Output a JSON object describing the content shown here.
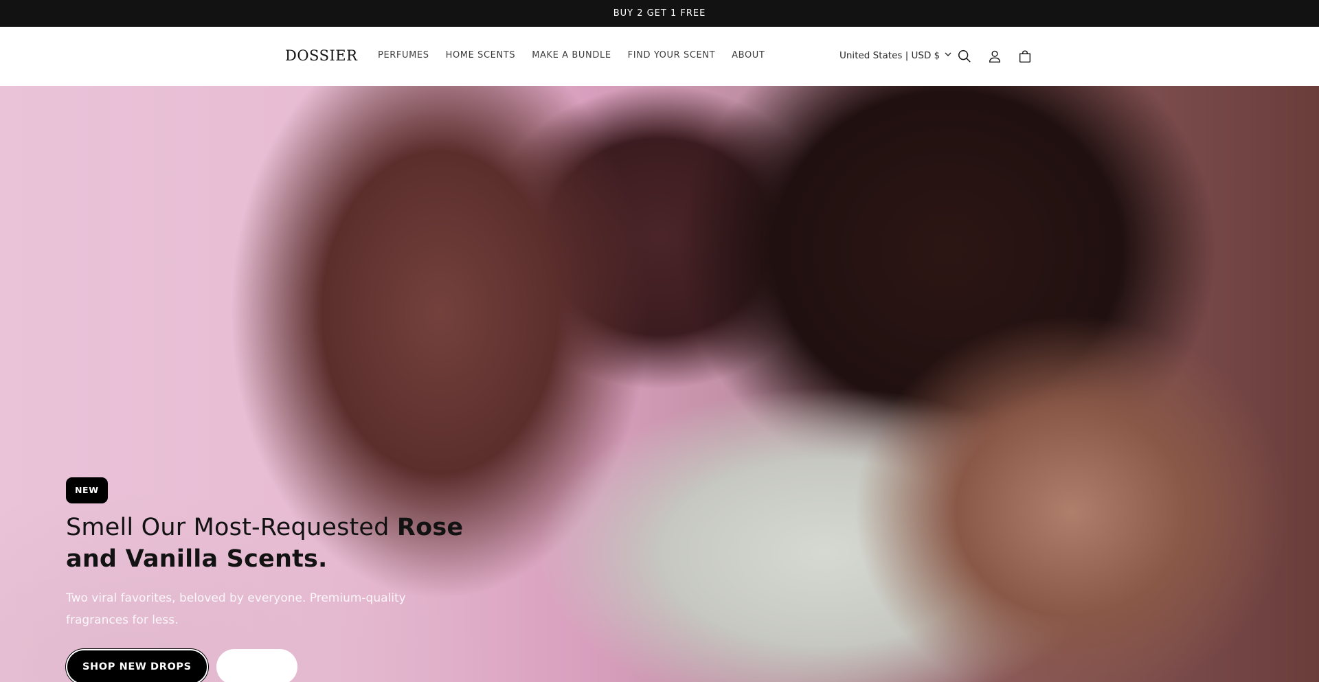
{
  "announcement": {
    "text": "BUY 2 GET 1 FREE"
  },
  "header": {
    "logo": "DOSSIER",
    "nav": [
      {
        "label": "PERFUMES"
      },
      {
        "label": "HOME SCENTS"
      },
      {
        "label": "MAKE A BUNDLE"
      },
      {
        "label": "FIND YOUR SCENT"
      },
      {
        "label": "ABOUT"
      }
    ],
    "locale": "United States | USD $",
    "icons": [
      "chevron-down-icon",
      "search-icon",
      "account-icon",
      "cart-icon"
    ]
  },
  "hero": {
    "badge": "NEW",
    "headline_light": "Smell Our Most-Requested ",
    "headline_bold": "Rose and Vanilla Scents.",
    "subtext": "Two viral favorites, beloved by everyone. Premium-quality fragrances for less.",
    "primary_button": "SHOP NEW DROPS",
    "secondary_button": ""
  },
  "colors": {
    "announcement_bg": "#121212",
    "badge_bg": "#000000",
    "primary_button_bg": "#000000",
    "hero_pink": "#e7bcd3"
  }
}
